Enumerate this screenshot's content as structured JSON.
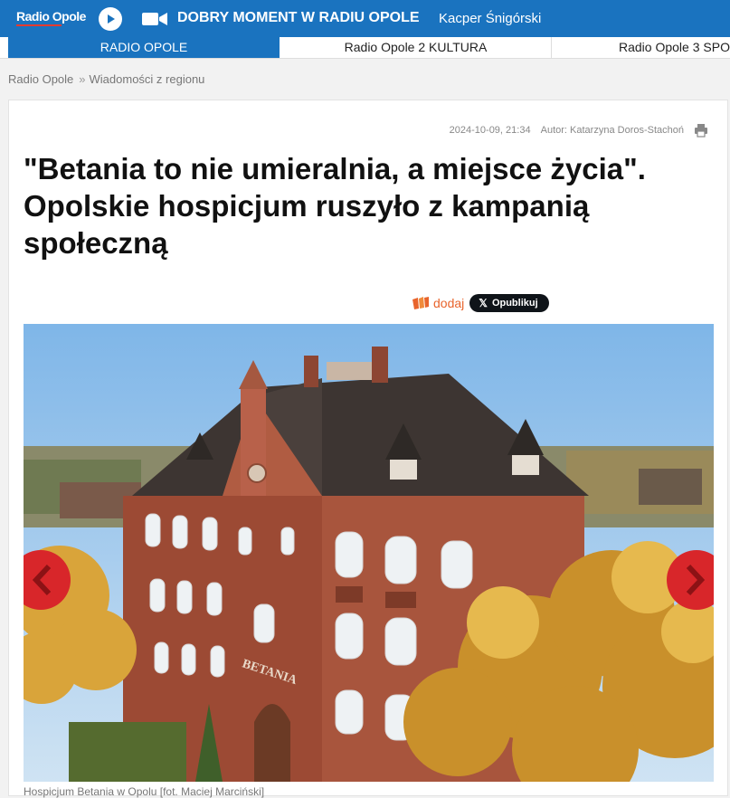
{
  "topbar": {
    "logo": "Radio Opole",
    "now_playing_title": "DOBRY MOMENT W RADIU OPOLE",
    "now_playing_artist": "Kacper Śnigórski",
    "colors": {
      "bar": "#1a73bf",
      "logo_accent": "#e53a2f"
    },
    "icons": [
      "play-icon",
      "video-camera-icon"
    ]
  },
  "tabs": [
    {
      "label": "RADIO OPOLE",
      "active": true
    },
    {
      "label": "Radio Opole 2 KULTURA",
      "active": false
    },
    {
      "label": "Radio Opole 3 SPO",
      "active": false
    }
  ],
  "breadcrumb": {
    "home": "Radio Opole",
    "separator": "»",
    "section": "Wiadomości z regionu"
  },
  "article": {
    "date": "2024-10-09, 21:34",
    "author": "Autor: Katarzyna Doros-Stachoń",
    "headline": "\"Betania to nie umieralnia, a miejsce życia\". Opolskie hospicjum ruszyło z kampanią społeczną",
    "share": {
      "wykop_label": "dodaj",
      "x_label": "Opublikuj",
      "x_glyph": "𝕏"
    },
    "photo": {
      "sign_text": "BETANIA",
      "caption": "Hospicjum Betania w Opolu [fot. Maciej Marciński]"
    },
    "icons": [
      "print-icon",
      "wykop-icon",
      "x-logo-icon",
      "arrow-left-icon",
      "arrow-right-icon"
    ]
  }
}
